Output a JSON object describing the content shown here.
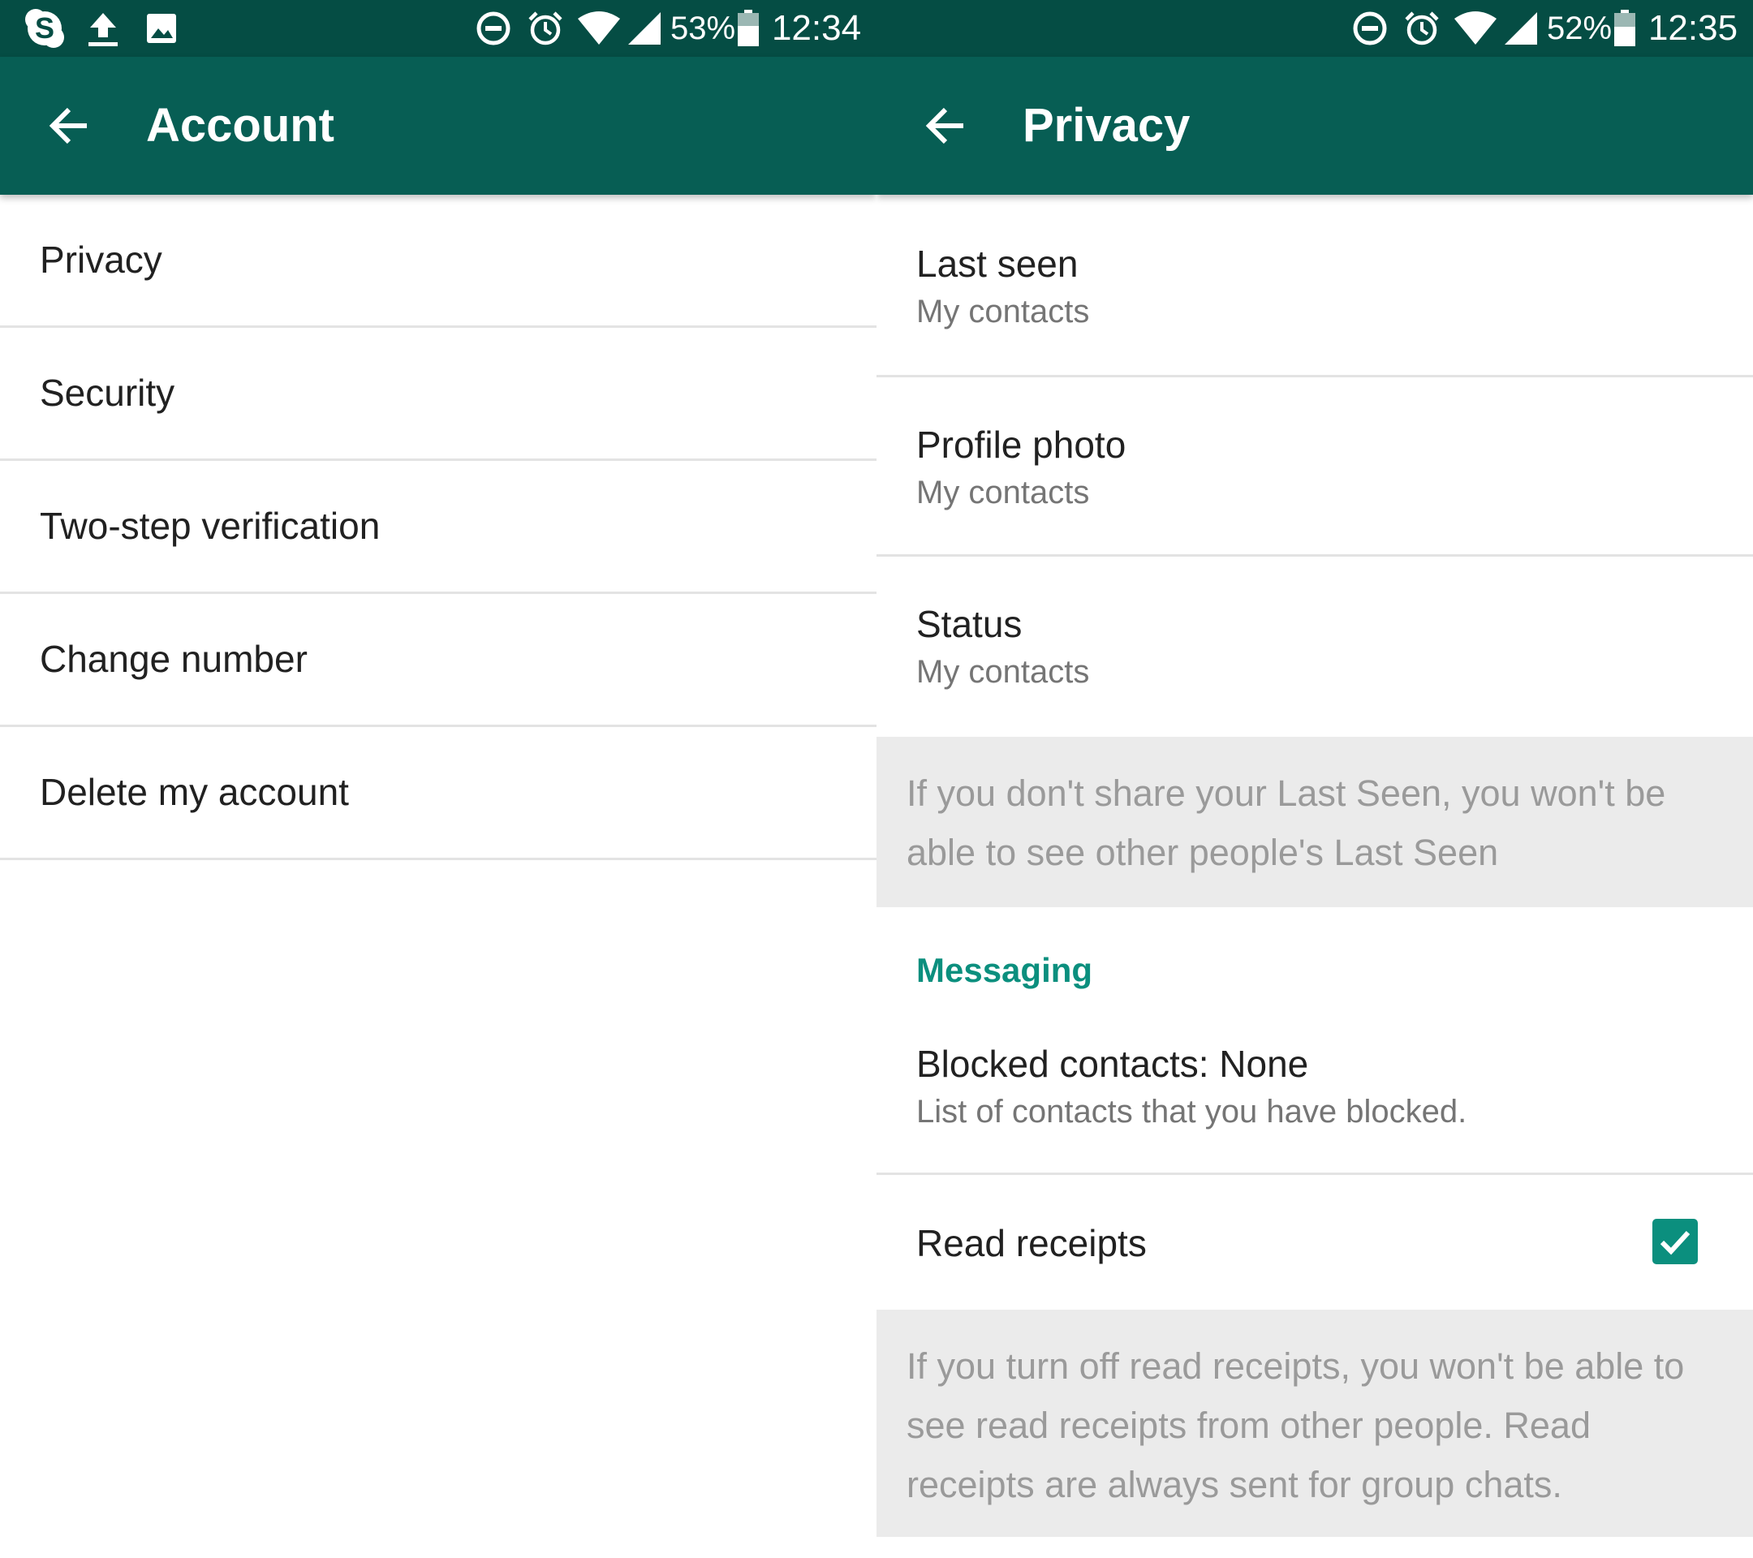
{
  "left": {
    "status_bar": {
      "icons": [
        "skype-icon",
        "upload-icon",
        "image-icon",
        "do-not-disturb-icon",
        "alarm-icon",
        "wifi-icon",
        "signal-icon",
        "battery-icon"
      ],
      "battery": "53%",
      "time": "12:34"
    },
    "app_bar": {
      "title": "Account",
      "back_icon": "arrow-left-icon"
    },
    "items": [
      {
        "label": "Privacy"
      },
      {
        "label": "Security"
      },
      {
        "label": "Two-step verification"
      },
      {
        "label": "Change number"
      },
      {
        "label": "Delete my account"
      }
    ]
  },
  "right": {
    "status_bar": {
      "icons": [
        "do-not-disturb-icon",
        "alarm-icon",
        "wifi-icon",
        "signal-icon",
        "battery-icon"
      ],
      "battery": "52%",
      "time": "12:35"
    },
    "app_bar": {
      "title": "Privacy",
      "back_icon": "arrow-left-icon"
    },
    "last_seen": {
      "title": "Last seen",
      "value": "My contacts"
    },
    "profile_photo": {
      "title": "Profile photo",
      "value": "My contacts"
    },
    "status": {
      "title": "Status",
      "value": "My contacts"
    },
    "last_seen_info": "If you don't share your Last Seen, you won't be able to see other people's Last Seen",
    "messaging_header": "Messaging",
    "blocked_contacts": {
      "title": "Blocked contacts: None",
      "subtitle": "List of contacts that you have blocked."
    },
    "read_receipts": {
      "title": "Read receipts",
      "checked": true
    },
    "read_receipts_info": "If you turn off read receipts, you won't be able to see read receipts from other people. Read receipts are always sent for group chats."
  },
  "colors": {
    "status_bar": "#054d44",
    "app_bar": "#075e54",
    "accent": "#0b8f7e",
    "info_background": "#ebebeb"
  }
}
